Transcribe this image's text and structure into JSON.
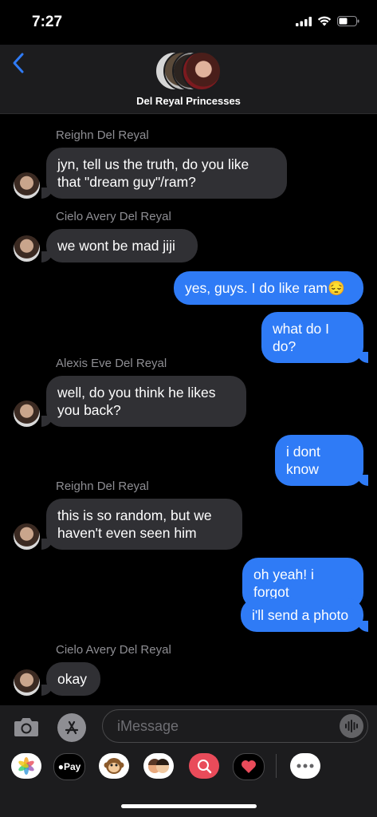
{
  "status": {
    "time": "7:27"
  },
  "header": {
    "title": "Del Reyal Princesses"
  },
  "messages": [
    {
      "sender": "Reighn Del Reyal",
      "text": "jyn, tell us the truth, do you like\nthat \"dream guy\"/ram?"
    },
    {
      "sender": "Cielo Avery Del Reyal",
      "text": "we wont be mad jiji"
    },
    {
      "text": "yes, guys. I do like ram😔"
    },
    {
      "text": "what do I do?"
    },
    {
      "sender": "Alexis Eve Del Reyal",
      "text": "well, do you think he likes\nyou back?"
    },
    {
      "text": "i dont know"
    },
    {
      "sender": "Reighn Del Reyal",
      "text": "this is so random, but we\nhaven't even seen him"
    },
    {
      "text": "oh yeah! i forgot"
    },
    {
      "text": "i'll send a photo"
    },
    {
      "sender": "Cielo Avery Del Reyal",
      "text": "okay"
    }
  ],
  "input": {
    "placeholder": "iMessage"
  },
  "tray": {
    "applepay_label": "Pay"
  },
  "colors": {
    "accent": "#2f7bf6",
    "incoming_bubble": "#303034"
  }
}
